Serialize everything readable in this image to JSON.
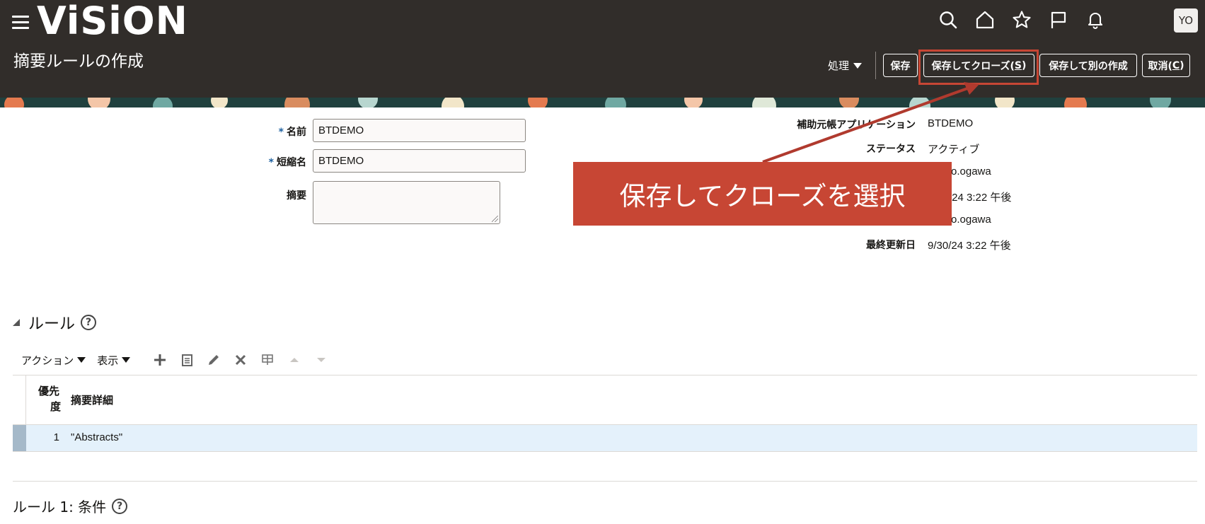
{
  "header": {
    "logo": "ViSiON",
    "page_title": "摘要ルールの作成",
    "avatar_initials": "YO",
    "actions_menu": "処理",
    "buttons": {
      "save": "保存",
      "save_close_prefix": "保存してクローズ(",
      "save_close_key": "S",
      "save_close_suffix": ")",
      "save_new": "保存して別の作成",
      "cancel_prefix": "取消(",
      "cancel_key": "C",
      "cancel_suffix": ")"
    }
  },
  "form": {
    "name_label": "名前",
    "name_value": "BTDEMO",
    "short_name_label": "短縮名",
    "short_name_value": "BTDEMO",
    "description_label": "摘要",
    "description_value": ""
  },
  "info": {
    "subledger_label": "補助元帳アプリケーション",
    "subledger_value": "BTDEMO",
    "status_label": "ステータス",
    "status_value": "アクティブ",
    "created_by_value": "o.ogawa",
    "created_date_value": "/24 3:22 午後",
    "updated_by_value": "o.ogawa",
    "last_updated_label": "最終更新日",
    "last_updated_value": "9/30/24 3:22 午後"
  },
  "callout": {
    "text": "保存してクローズを選択"
  },
  "rules": {
    "title": "ルール",
    "help": "?",
    "toolbar": {
      "actions": "アクション",
      "view": "表示"
    },
    "columns": {
      "priority_line1": "優先",
      "priority_line2": "度",
      "detail": "摘要詳細"
    },
    "rows": [
      {
        "priority": "1",
        "detail": "\"Abstracts\""
      }
    ]
  },
  "conditions": {
    "title": "ルール 1: 条件",
    "help": "?"
  },
  "colors": {
    "header_bg": "#312d2a",
    "accent_red": "#c74634",
    "row_selected": "#e4f1fb"
  }
}
